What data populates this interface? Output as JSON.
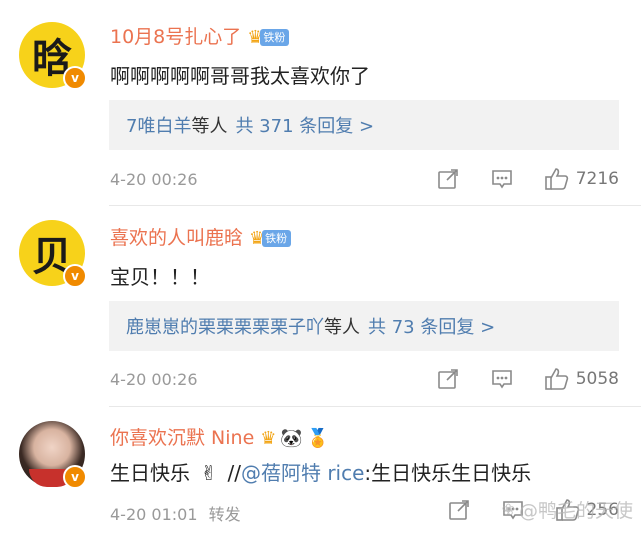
{
  "comments": [
    {
      "avatar_char": "晗",
      "username": "10月8号扎心了",
      "fan_tag": "铁粉",
      "text": "啊啊啊啊啊哥哥我太喜欢你了",
      "replies_who": "7唯白羊",
      "replies_mid": "等人",
      "replies_count": "共 371 条回复 >",
      "time": "4-20 00:26",
      "likes": "7216"
    },
    {
      "avatar_char": "贝",
      "username": "喜欢的人叫鹿晗",
      "fan_tag": "铁粉",
      "text": "宝贝！！！",
      "replies_who": "鹿崽崽的栗栗栗栗栗子吖",
      "replies_mid": "等人",
      "replies_count": "共 73 条回复 >",
      "time": "4-20 00:26",
      "likes": "5058"
    },
    {
      "username": "你喜欢沉默 Nine",
      "text_prefix": "生日快乐",
      "text_emoji": "✌",
      "text_slash": " //",
      "mention": "@蓓阿特 rice",
      "text_suffix": ":生日快乐生日快乐",
      "time": "4-20 01:01",
      "repost": "转发",
      "likes": "256"
    }
  ],
  "badges": {
    "verified": "v",
    "crown": "♛",
    "panda": "🐼",
    "medal": "🏅"
  },
  "watermark": "@鸭毛的天使",
  "icons": [
    "share-icon",
    "comment-icon",
    "like-icon",
    "verified-icon",
    "crown-icon"
  ]
}
